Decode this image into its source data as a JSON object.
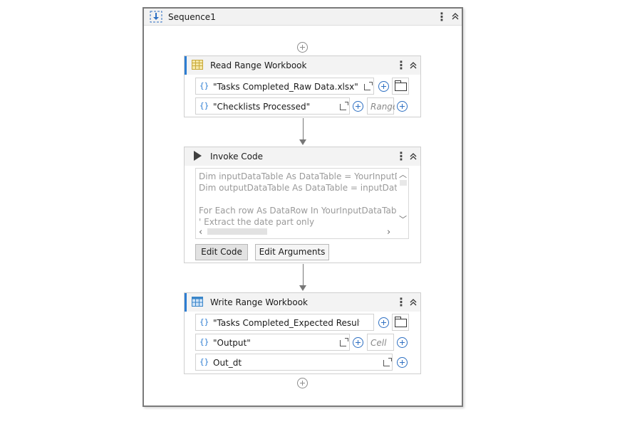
{
  "sequence": {
    "title": "Sequence1",
    "more_icon": "⋮",
    "collapse_icon": "double-chevron-up"
  },
  "read_range": {
    "title": "Read Range Workbook",
    "workbook_path": "\"Tasks Completed_Raw Data.xlsx\"",
    "sheet_name": "\"Checklists Processed\"",
    "range_placeholder": "Range",
    "brace": "{}"
  },
  "invoke_code": {
    "title": "Invoke Code",
    "code_lines": [
      "Dim inputDataTable As DataTable = YourInputDataTable",
      "Dim outputDataTable As DataTable = inputDataTable.Clone",
      "",
      "For Each row As DataRow In YourInputDataTable.Rows",
      "    ' Extract the date part only"
    ],
    "edit_code_label": "Edit Code",
    "edit_arguments_label": "Edit Arguments"
  },
  "write_range": {
    "title": "Write Range Workbook",
    "workbook_path": "\"Tasks Completed_Expected Result.xlsx\"",
    "sheet_name": "\"Output\"",
    "cell_placeholder": "Cell",
    "datatable": "Out_dt",
    "brace": "{}"
  },
  "colors": {
    "accent": "#2d7dd2",
    "header_bg": "#f3f3f3"
  }
}
